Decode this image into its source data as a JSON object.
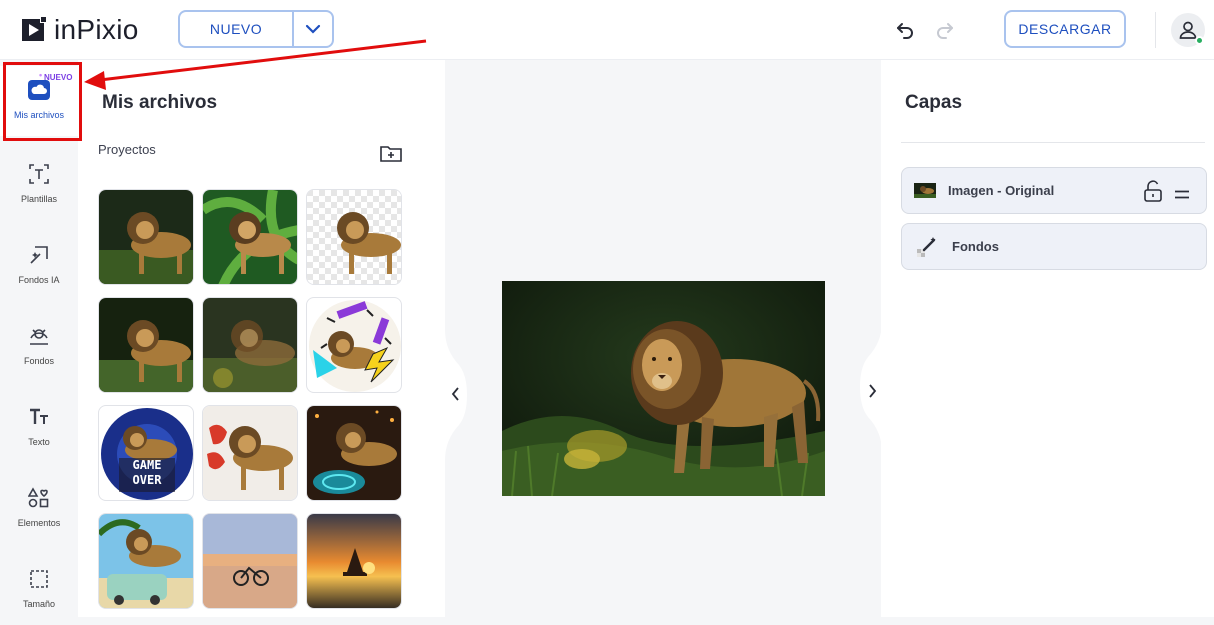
{
  "app": {
    "name": "inPixio"
  },
  "header": {
    "new_label": "NUEVO",
    "download_label": "DESCARGAR"
  },
  "sidebar": {
    "new_badge": "NUEVO",
    "items": [
      {
        "label": "Mis archivos",
        "icon": "cloud-icon",
        "active": true
      },
      {
        "label": "Plantillas",
        "icon": "templates-icon"
      },
      {
        "label": "Fondos IA",
        "icon": "ai-background-icon"
      },
      {
        "label": "Fondos",
        "icon": "backgrounds-icon"
      },
      {
        "label": "Texto",
        "icon": "text-icon"
      },
      {
        "label": "Elementos",
        "icon": "elements-icon"
      },
      {
        "label": "Tamaño",
        "icon": "resize-icon"
      }
    ]
  },
  "files_panel": {
    "title": "Mis archivos",
    "section_label": "Proyectos",
    "thumbnails": [
      {
        "name": "lion-original"
      },
      {
        "name": "lion-leaves-background"
      },
      {
        "name": "lion-transparent-background"
      },
      {
        "name": "lion-dark-grass"
      },
      {
        "name": "lion-blurred"
      },
      {
        "name": "lion-memphis-circle"
      },
      {
        "name": "lion-game-over"
      },
      {
        "name": "lion-balloon-letters"
      },
      {
        "name": "lion-neon-portal"
      },
      {
        "name": "lion-palm-beach"
      },
      {
        "name": "beach-bicycles"
      },
      {
        "name": "sailboat-sunset"
      }
    ],
    "thumbnail_texts": {
      "game_over_1": "GAME",
      "game_over_2": "OVER"
    }
  },
  "layers_panel": {
    "title": "Capas",
    "layers": [
      {
        "label": "Imagen - Original"
      },
      {
        "label": "Fondos"
      }
    ]
  },
  "colors": {
    "accent": "#1e4fbf",
    "accent_border": "#a9c3ee",
    "highlight_red": "#e10d0d",
    "badge_purple": "#7b3fe4"
  }
}
